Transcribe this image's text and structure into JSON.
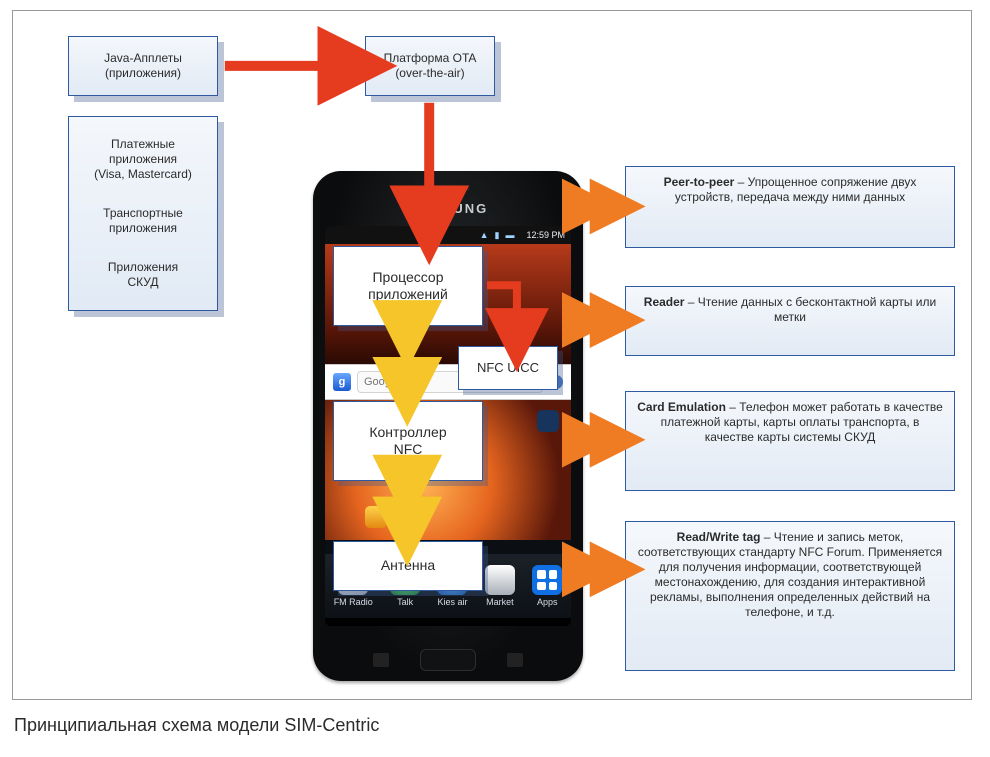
{
  "caption": "Принципиальная схема модели SIM-Centric",
  "left": {
    "applets_l1": "Java-Апплеты",
    "applets_l2": "(приложения)",
    "apps_l1": "Платежные",
    "apps_l2": "приложения",
    "apps_l3": "(Visa, Mastercard)",
    "apps_l4": "Транспортные",
    "apps_l5": "приложения",
    "apps_l6": "Приложения",
    "apps_l7": "СКУД"
  },
  "top": {
    "ota_l1": "Платформа OTA",
    "ota_l2": "(over-the-air)"
  },
  "phone": {
    "brand": "SAMSUNG",
    "status_time": "12:59 PM",
    "search_placeholder": "Google",
    "dock": [
      "FM Radio",
      "Talk",
      "Kies air",
      "Market",
      "Apps"
    ],
    "box_proc_l1": "Процессор",
    "box_proc_l2": "приложений",
    "box_uicc": "NFC UICC",
    "box_ctrl_l1": "Контроллер",
    "box_ctrl_l2": "NFC",
    "box_antenna": "Антенна"
  },
  "right": {
    "p2p_b": "Peer-to-peer",
    "p2p_t": " – Упрощенное сопряжение двух устройств, передача между ними данных",
    "reader_b": "Reader",
    "reader_t": " – Чтение данных с бесконтактной карты или метки",
    "ce_b": "Card Emulation",
    "ce_t": " – Телефон может работать в качестве платежной карты, карты оплаты транспорта, в качестве карты системы СКУД",
    "rw_b": "Read/Write tag",
    "rw_t": " – Чтение и запись меток, соответствующих стандарту NFC Forum. Применяется для получения информации, соответствующей местонахождению, для создания интерактивной рекламы, выполнения определенных действий на телефоне, и т.д."
  }
}
